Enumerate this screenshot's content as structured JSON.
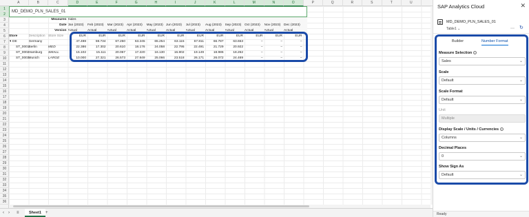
{
  "sheet": {
    "columns": [
      "A",
      "B",
      "C",
      "D",
      "E",
      "F",
      "G",
      "H",
      "I",
      "J",
      "K",
      "L",
      "M",
      "N",
      "O",
      "P",
      "Q",
      "R",
      "S",
      "T",
      "U"
    ],
    "rows": [
      "1",
      "2",
      "3",
      "4",
      "5",
      "6",
      "7",
      "8",
      "9",
      "10",
      "11",
      "12",
      "13",
      "14",
      "15",
      "16",
      "17",
      "18",
      "19",
      "20",
      "21",
      "22",
      "23",
      "24",
      "25",
      "26",
      "27",
      "28",
      "29",
      "30",
      "31",
      "32",
      "33",
      "34",
      "35",
      "36"
    ],
    "title": "MD_DEMO_PLN_SALES_01",
    "measures_label": "Measures",
    "measures_value": "Sales",
    "date_label": "Date",
    "version_label": "Version",
    "months": [
      "Jan (2023)",
      "Feb (2023)",
      "Mar (2023)",
      "Apr (2023)",
      "May (2023)",
      "Jun (2023)",
      "Jul (2023)",
      "Aug (2023)",
      "Sep (2023)",
      "Oct (2023)",
      "Nov (2023)",
      "Dec (2023)"
    ],
    "version_value": "Actual",
    "store_header": "Store",
    "description_header": "Description",
    "store_size_header": "Store Size",
    "currency": "EUR",
    "dash": "–",
    "data_rows": [
      {
        "store": "DE",
        "desc": "Germany",
        "size": "",
        "values": [
          "47.498",
          "59.734",
          "67.250",
          "63.245",
          "65.254",
          "63.115",
          "67.811",
          "66.787",
          "63.653"
        ]
      },
      {
        "store": "ST_0001",
        "desc": "Berlin",
        "size": "MED",
        "values": [
          "22.386",
          "17.302",
          "20.610",
          "18.176",
          "24.058",
          "22.795",
          "22.491",
          "21.729",
          "20.922"
        ]
      },
      {
        "store": "ST_0002",
        "desc": "Hamburg",
        "size": "SMALL",
        "values": [
          "15.102",
          "15.111",
          "20.067",
          "17.220",
          "16.130",
          "16.802",
          "19.149",
          "18.986",
          "18.262"
        ]
      },
      {
        "store": "ST_0003",
        "desc": "Munich",
        "size": "LARGE",
        "values": [
          "10.000",
          "27.321",
          "26.573",
          "27.849",
          "25.066",
          "23.518",
          "26.171",
          "26.072",
          "24.469"
        ]
      }
    ]
  },
  "tabs": {
    "sheet_name": "Sheet1",
    "add_label": "+",
    "menu_label": "≡"
  },
  "panel": {
    "title": "SAP Analytics Cloud",
    "close": "✕",
    "model_name": "MD_DEMO_PLN_SALES_01",
    "table_selector": "Table1",
    "tab_builder": "Builder",
    "tab_number_format": "Number Format",
    "measure_selection_label": "Measure Selection",
    "measure_selection_value": "Sales",
    "scale_label": "Scale",
    "scale_value": "Default",
    "scale_format_label": "Scale Format",
    "scale_format_value": "Default",
    "unit_label": "Unit",
    "unit_value": "Multiple",
    "display_label": "Display Scale / Units / Currencies",
    "display_value": "Columns",
    "decimal_label": "Decimal Places",
    "decimal_value": "0",
    "sign_label": "Show Sign As",
    "sign_value": "Default",
    "status": "Ready"
  },
  "colors": {
    "accent": "#1a4aa8",
    "excel_green": "#217346",
    "sap_blue": "#0a6ed1"
  }
}
